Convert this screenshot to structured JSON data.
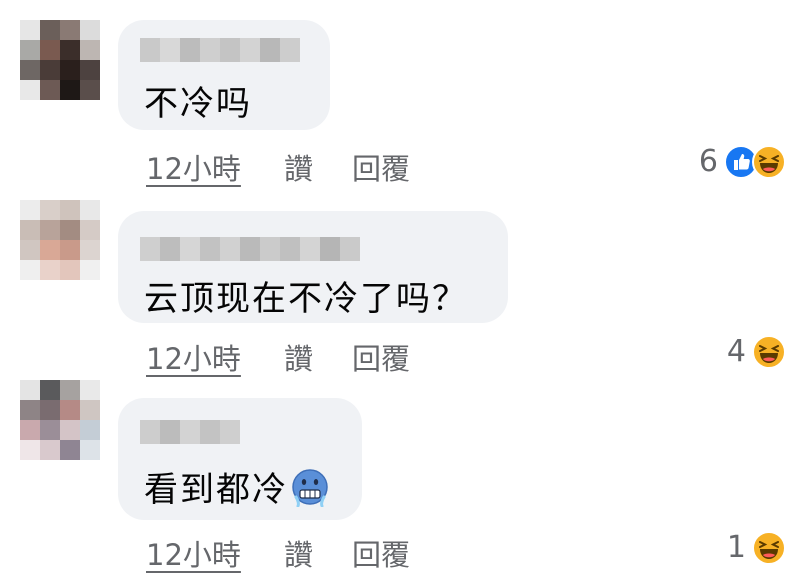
{
  "comments": [
    {
      "text": "不冷吗",
      "time": "12小時",
      "like": "讚",
      "reply": "回覆",
      "reaction_count": "6",
      "reactions": [
        "like-icon",
        "haha-icon"
      ]
    },
    {
      "text": "云顶现在不冷了吗？",
      "time": "12小時",
      "like": "讚",
      "reply": "回覆",
      "reaction_count": "4",
      "reactions": [
        "haha-icon"
      ]
    },
    {
      "text": "看到都冷",
      "text_emoji": "cold-face-emoji-icon",
      "time": "12小時",
      "like": "讚",
      "reply": "回覆",
      "reaction_count": "1",
      "reactions": [
        "haha-icon"
      ]
    }
  ],
  "colors": {
    "bubble": "#f0f2f5",
    "meta_text": "#65676b",
    "like_blue": "#1877f2",
    "haha_yellow": "#f7b125"
  }
}
